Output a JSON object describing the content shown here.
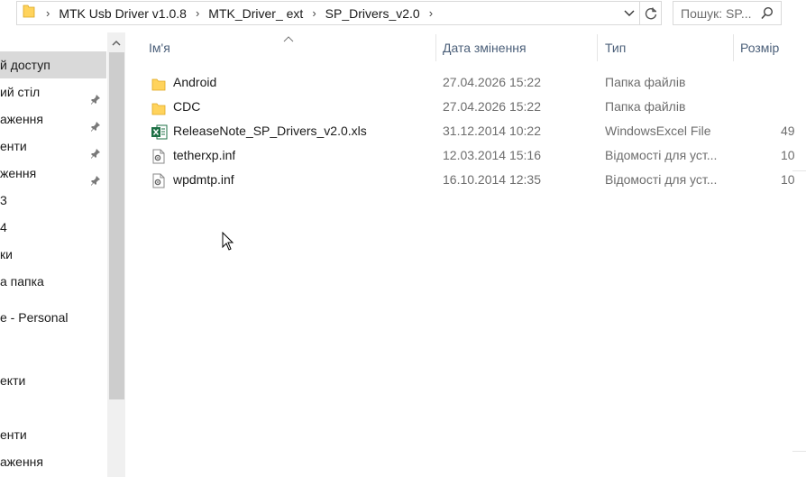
{
  "address": {
    "crumbs": [
      "MTK Usb Driver v1.0.8",
      "MTK_Driver_ ext",
      "SP_Drivers_v2.0"
    ]
  },
  "search": {
    "placeholder": "Пошук: SP..."
  },
  "nav": {
    "items": [
      {
        "label": "й доступ",
        "selected": true,
        "pinned": false
      },
      {
        "label": "ий стіл",
        "selected": false,
        "pinned": true
      },
      {
        "label": "аження",
        "selected": false,
        "pinned": true
      },
      {
        "label": "енти",
        "selected": false,
        "pinned": true
      },
      {
        "label": "ження",
        "selected": false,
        "pinned": true
      },
      {
        "label": "3",
        "selected": false,
        "pinned": false
      },
      {
        "label": "4",
        "selected": false,
        "pinned": false
      },
      {
        "label": "ки",
        "selected": false,
        "pinned": false
      },
      {
        "label": "а папка",
        "selected": false,
        "pinned": false
      },
      {
        "label": "e - Personal",
        "selected": false,
        "pinned": false
      },
      {
        "label": "",
        "selected": false,
        "pinned": false
      },
      {
        "label": "екти",
        "selected": false,
        "pinned": false
      },
      {
        "label": "",
        "selected": false,
        "pinned": false
      },
      {
        "label": "енти",
        "selected": false,
        "pinned": false
      },
      {
        "label": "аження",
        "selected": false,
        "pinned": false
      }
    ]
  },
  "columns": {
    "name": "Ім'я",
    "date": "Дата змінення",
    "type": "Тип",
    "size": "Розмір"
  },
  "files": [
    {
      "name": "Android",
      "date": "27.04.2026 15:22",
      "type": "Папка файлів",
      "size": "",
      "icon": "folder-icon"
    },
    {
      "name": "CDC",
      "date": "27.04.2026 15:22",
      "type": "Папка файлів",
      "size": "",
      "icon": "folder-icon"
    },
    {
      "name": "ReleaseNote_SP_Drivers_v2.0.xls",
      "date": "31.12.2014 10:22",
      "type": "WindowsExcel File",
      "size": "49",
      "icon": "excel-file-icon"
    },
    {
      "name": "tetherxp.inf",
      "date": "12.03.2014 15:16",
      "type": "Відомості для уст...",
      "size": "10",
      "icon": "setup-info-file-icon"
    },
    {
      "name": "wpdmtp.inf",
      "date": "16.10.2014 12:35",
      "type": "Відомості для уст...",
      "size": "10",
      "icon": "setup-info-file-icon"
    }
  ],
  "colors": {
    "selected_nav": "#d9d9d9",
    "header_text": "#4c607a",
    "folder": "#ffd35c",
    "excel": "#1e7145"
  }
}
